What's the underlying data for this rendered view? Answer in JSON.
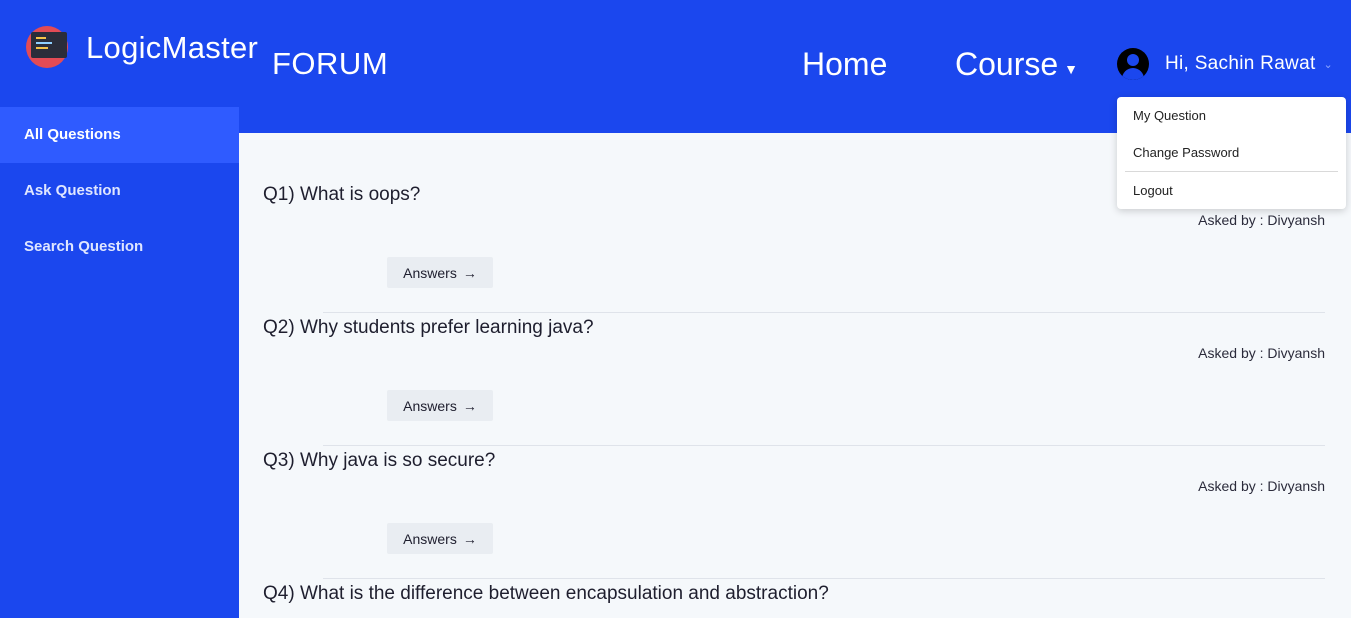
{
  "brand": {
    "name": "LogicMaster"
  },
  "header": {
    "title": "FORUM",
    "nav": {
      "home": "Home",
      "course": "Course"
    },
    "user": {
      "greeting": "Hi, Sachin Rawat"
    }
  },
  "sidebar": {
    "items": [
      {
        "label": "All Questions",
        "active": true
      },
      {
        "label": "Ask Question",
        "active": false
      },
      {
        "label": "Search Question",
        "active": false
      }
    ]
  },
  "dropdown": {
    "items": [
      "My Question",
      "Change Password",
      "Logout"
    ]
  },
  "questions": [
    {
      "title": "Q1) What is oops?",
      "asked_by": "Asked by : Divyansh",
      "button": "Answers"
    },
    {
      "title": "Q2) Why students prefer learning java?",
      "asked_by": "Asked by : Divyansh",
      "button": "Answers"
    },
    {
      "title": "Q3) Why java is so secure?",
      "asked_by": "Asked by : Divyansh",
      "button": "Answers"
    },
    {
      "title": "Q4) What is the difference between encapsulation and abstraction?"
    }
  ],
  "colors": {
    "brand_blue": "#1b47ee",
    "active_item": "#2f5bff",
    "content_bg": "#f5f8fb"
  }
}
